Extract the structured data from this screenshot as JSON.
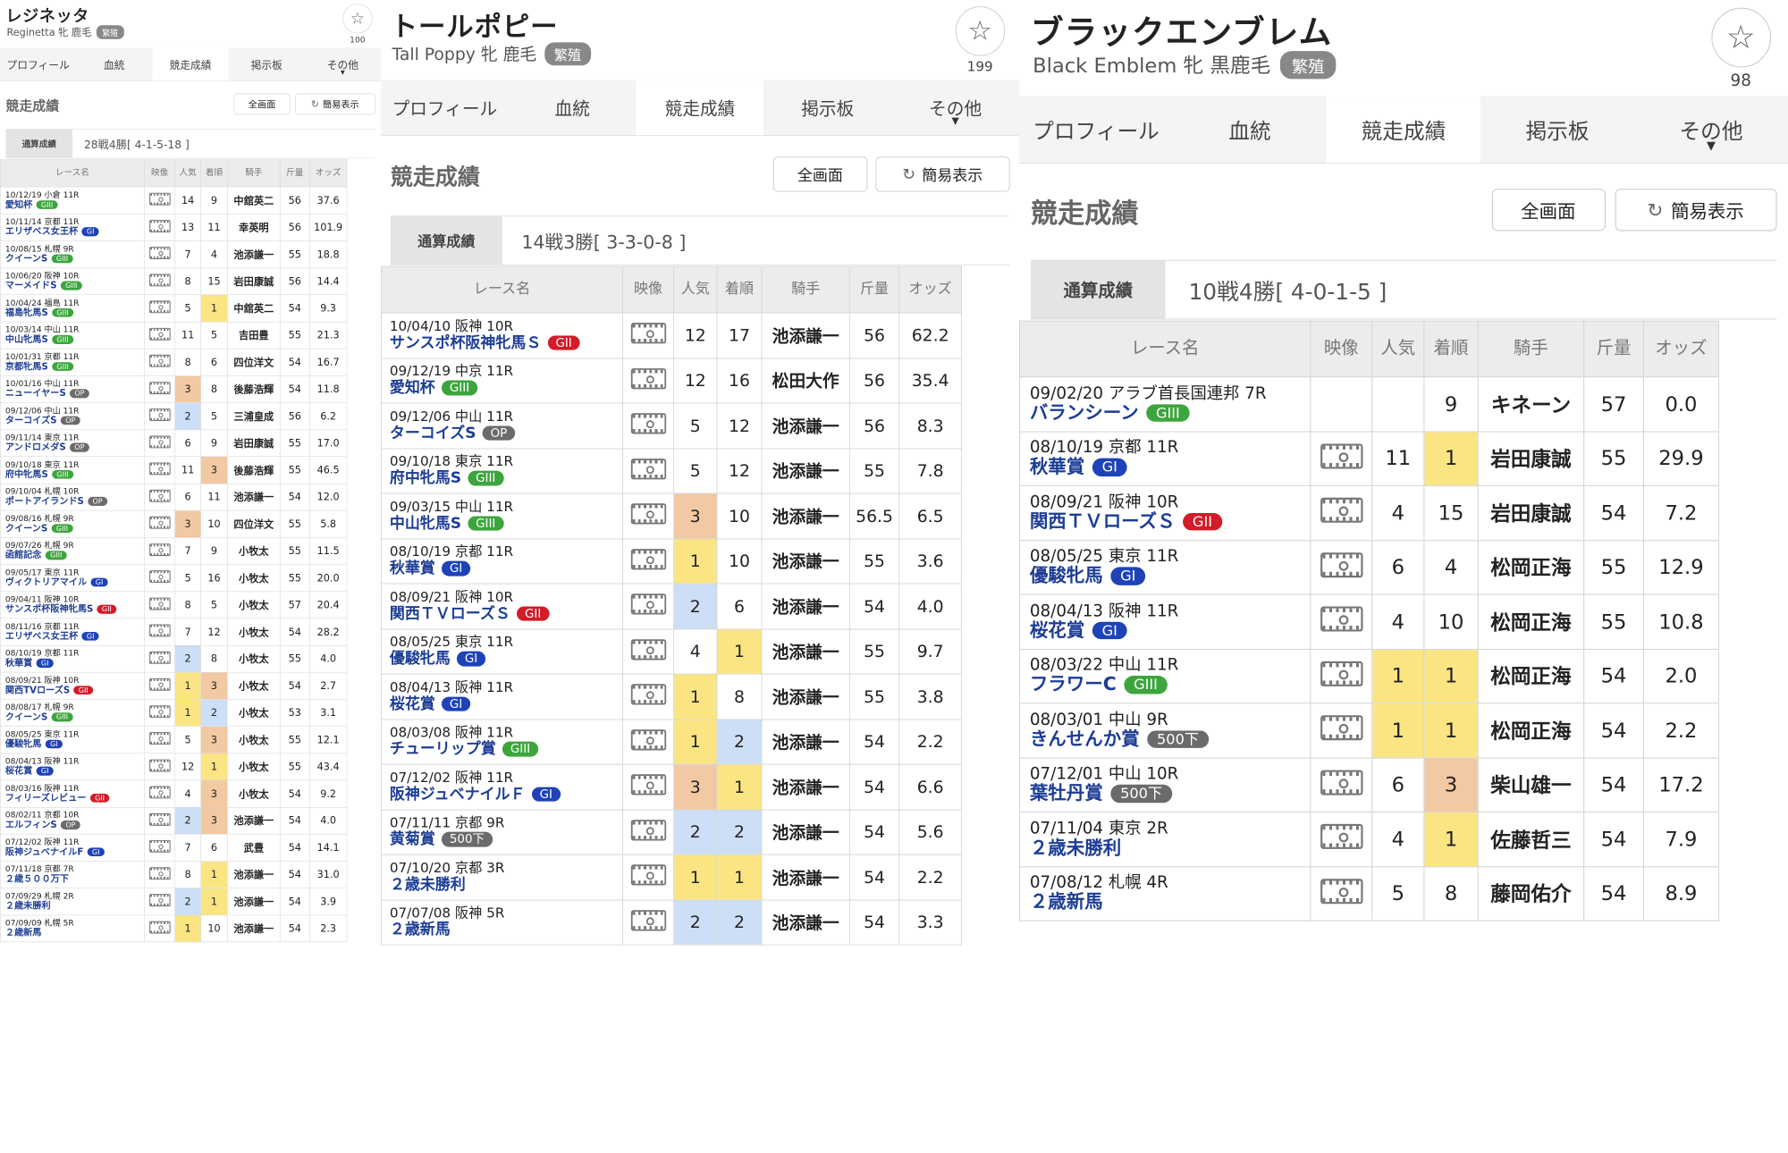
{
  "tabs": [
    "プロフィール",
    "血統",
    "競走成績",
    "掲示板",
    "その他"
  ],
  "section_title": "競走成績",
  "fullscreen_label": "全画面",
  "simple_label": "簡易表示",
  "summary_label": "通算成績",
  "headers": [
    "レース名",
    "映像",
    "人気",
    "着順",
    "騎手",
    "斤量",
    "オッズ"
  ],
  "colors": {
    "grade_GI": "#1e43b8",
    "grade_GII": "#d21c28",
    "grade_GIII": "#3da53d",
    "first": "#fbe582",
    "second": "#cddff6",
    "third": "#f2c9a3"
  },
  "horses": [
    {
      "name": "レジネッタ",
      "sub": "Reginetta 牝 鹿毛",
      "badge": "繁殖",
      "favorites": "100",
      "summary": "28戦4勝[ 4-1-5-18 ]",
      "races": [
        {
          "date": "10/12/19 小倉 11R",
          "name": "愛知杯",
          "grade": "GIII",
          "video": true,
          "pop": "14",
          "pos": "9",
          "jockey": "中舘英二",
          "weight": "56",
          "odds": "37.6"
        },
        {
          "date": "10/11/14 京都 11R",
          "name": "エリザベス女王杯",
          "grade": "GI",
          "video": true,
          "pop": "13",
          "pos": "11",
          "jockey": "幸英明",
          "weight": "56",
          "odds": "101.9"
        },
        {
          "date": "10/08/15 札幌 9R",
          "name": "クイーンS",
          "grade": "GIII",
          "video": true,
          "pop": "7",
          "pos": "4",
          "jockey": "池添謙一",
          "weight": "55",
          "odds": "18.8"
        },
        {
          "date": "10/06/20 阪神 10R",
          "name": "マーメイドS",
          "grade": "GIII",
          "video": true,
          "pop": "8",
          "pos": "15",
          "jockey": "岩田康誠",
          "weight": "56",
          "odds": "14.4"
        },
        {
          "date": "10/04/24 福島 11R",
          "name": "福島牝馬S",
          "grade": "GIII",
          "video": true,
          "pop": "5",
          "pos": "1",
          "jockey": "中舘英二",
          "weight": "54",
          "odds": "9.3"
        },
        {
          "date": "10/03/14 中山 11R",
          "name": "中山牝馬S",
          "grade": "GIII",
          "video": true,
          "pop": "11",
          "pos": "5",
          "jockey": "吉田豊",
          "weight": "55",
          "odds": "21.3"
        },
        {
          "date": "10/01/31 京都 11R",
          "name": "京都牝馬S",
          "grade": "GIII",
          "video": true,
          "pop": "8",
          "pos": "6",
          "jockey": "四位洋文",
          "weight": "54",
          "odds": "16.7"
        },
        {
          "date": "10/01/16 中山 11R",
          "name": "ニューイヤーS",
          "grade": "OP",
          "video": true,
          "pop": "3",
          "pos": "8",
          "jockey": "後藤浩輝",
          "weight": "54",
          "odds": "11.8"
        },
        {
          "date": "09/12/06 中山 11R",
          "name": "ターコイズS",
          "grade": "OP",
          "video": true,
          "pop": "2",
          "pos": "5",
          "jockey": "三浦皇成",
          "weight": "56",
          "odds": "6.2"
        },
        {
          "date": "09/11/14 東京 11R",
          "name": "アンドロメダS",
          "grade": "OP",
          "video": true,
          "pop": "6",
          "pos": "9",
          "jockey": "岩田康誠",
          "weight": "55",
          "odds": "17.0"
        },
        {
          "date": "09/10/18 東京 11R",
          "name": "府中牝馬S",
          "grade": "GIII",
          "video": true,
          "pop": "11",
          "pos": "3",
          "jockey": "後藤浩輝",
          "weight": "55",
          "odds": "46.5"
        },
        {
          "date": "09/10/04 札幌 10R",
          "name": "ポートアイランドS",
          "grade": "OP",
          "video": true,
          "pop": "6",
          "pos": "11",
          "jockey": "池添謙一",
          "weight": "54",
          "odds": "12.0"
        },
        {
          "date": "09/08/16 札幌 9R",
          "name": "クイーンS",
          "grade": "GIII",
          "video": true,
          "pop": "3",
          "pos": "10",
          "jockey": "四位洋文",
          "weight": "55",
          "odds": "5.8"
        },
        {
          "date": "09/07/26 札幌 9R",
          "name": "函館記念",
          "grade": "GIII",
          "video": true,
          "pop": "7",
          "pos": "9",
          "jockey": "小牧太",
          "weight": "55",
          "odds": "11.5"
        },
        {
          "date": "09/05/17 東京 11R",
          "name": "ヴィクトリアマイル",
          "grade": "GI",
          "video": true,
          "pop": "5",
          "pos": "16",
          "jockey": "小牧太",
          "weight": "55",
          "odds": "20.0"
        },
        {
          "date": "09/04/11 阪神 10R",
          "name": "サンスポ杯阪神牝馬S",
          "grade": "GII",
          "video": true,
          "pop": "8",
          "pos": "5",
          "jockey": "小牧太",
          "weight": "57",
          "odds": "20.4"
        },
        {
          "date": "08/11/16 京都 11R",
          "name": "エリザベス女王杯",
          "grade": "GI",
          "video": true,
          "pop": "7",
          "pos": "12",
          "jockey": "小牧太",
          "weight": "54",
          "odds": "28.2"
        },
        {
          "date": "08/10/19 京都 11R",
          "name": "秋華賞",
          "grade": "GI",
          "video": true,
          "pop": "2",
          "pos": "8",
          "jockey": "小牧太",
          "weight": "55",
          "odds": "4.0"
        },
        {
          "date": "08/09/21 阪神 10R",
          "name": "関西TVローズS",
          "grade": "GII",
          "video": true,
          "pop": "1",
          "pos": "3",
          "jockey": "小牧太",
          "weight": "54",
          "odds": "2.7"
        },
        {
          "date": "08/08/17 札幌 9R",
          "name": "クイーンS",
          "grade": "GIII",
          "video": true,
          "pop": "1",
          "pos": "2",
          "jockey": "小牧太",
          "weight": "53",
          "odds": "3.1"
        },
        {
          "date": "08/05/25 東京 11R",
          "name": "優駿牝馬",
          "grade": "GI",
          "video": true,
          "pop": "5",
          "pos": "3",
          "jockey": "小牧太",
          "weight": "55",
          "odds": "12.1"
        },
        {
          "date": "08/04/13 阪神 11R",
          "name": "桜花賞",
          "grade": "GI",
          "video": true,
          "pop": "12",
          "pos": "1",
          "jockey": "小牧太",
          "weight": "55",
          "odds": "43.4"
        },
        {
          "date": "08/03/16 阪神 11R",
          "name": "フィリーズレビュー",
          "grade": "GII",
          "video": true,
          "pop": "4",
          "pos": "3",
          "jockey": "小牧太",
          "weight": "54",
          "odds": "9.2"
        },
        {
          "date": "08/02/11 京都 10R",
          "name": "エルフィンS",
          "grade": "OP",
          "video": true,
          "pop": "2",
          "pos": "3",
          "jockey": "池添謙一",
          "weight": "54",
          "odds": "4.0"
        },
        {
          "date": "07/12/02 阪神 11R",
          "name": "阪神ジュベナイルF",
          "grade": "GI",
          "video": true,
          "pop": "7",
          "pos": "6",
          "jockey": "武豊",
          "weight": "54",
          "odds": "14.1"
        },
        {
          "date": "07/11/18 京都 7R",
          "name": "２歳５００万下",
          "grade": "",
          "video": true,
          "pop": "8",
          "pos": "1",
          "jockey": "池添謙一",
          "weight": "54",
          "odds": "31.0"
        },
        {
          "date": "07/09/29 札幌 2R",
          "name": "２歳未勝利",
          "grade": "",
          "video": true,
          "pop": "2",
          "pos": "1",
          "jockey": "池添謙一",
          "weight": "54",
          "odds": "3.9"
        },
        {
          "date": "07/09/09 札幌 5R",
          "name": "２歳新馬",
          "grade": "",
          "video": true,
          "pop": "1",
          "pos": "10",
          "jockey": "池添謙一",
          "weight": "54",
          "odds": "2.3"
        }
      ]
    },
    {
      "name": "トールポピー",
      "sub": "Tall Poppy 牝 鹿毛",
      "badge": "繁殖",
      "favorites": "199",
      "summary": "14戦3勝[ 3-3-0-8 ]",
      "races": [
        {
          "date": "10/04/10 阪神 10R",
          "name": "サンスポ杯阪神牝馬Ｓ",
          "grade": "GII",
          "video": true,
          "pop": "12",
          "pos": "17",
          "jockey": "池添謙一",
          "weight": "56",
          "odds": "62.2"
        },
        {
          "date": "09/12/19 中京 11R",
          "name": "愛知杯",
          "grade": "GIII",
          "video": true,
          "pop": "12",
          "pos": "16",
          "jockey": "松田大作",
          "weight": "56",
          "odds": "35.4"
        },
        {
          "date": "09/12/06 中山 11R",
          "name": "ターコイズS",
          "grade": "OP",
          "video": true,
          "pop": "5",
          "pos": "12",
          "jockey": "池添謙一",
          "weight": "56",
          "odds": "8.3"
        },
        {
          "date": "09/10/18 東京 11R",
          "name": "府中牝馬S",
          "grade": "GIII",
          "video": true,
          "pop": "5",
          "pos": "12",
          "jockey": "池添謙一",
          "weight": "55",
          "odds": "7.8"
        },
        {
          "date": "09/03/15 中山 11R",
          "name": "中山牝馬S",
          "grade": "GIII",
          "video": true,
          "pop": "3",
          "pos": "10",
          "jockey": "池添謙一",
          "weight": "56.5",
          "odds": "6.5"
        },
        {
          "date": "08/10/19 京都 11R",
          "name": "秋華賞",
          "grade": "GI",
          "video": true,
          "pop": "1",
          "pos": "10",
          "jockey": "池添謙一",
          "weight": "55",
          "odds": "3.6"
        },
        {
          "date": "08/09/21 阪神 10R",
          "name": "関西ＴＶローズＳ",
          "grade": "GII",
          "video": true,
          "pop": "2",
          "pos": "6",
          "jockey": "池添謙一",
          "weight": "54",
          "odds": "4.0"
        },
        {
          "date": "08/05/25 東京 11R",
          "name": "優駿牝馬",
          "grade": "GI",
          "video": true,
          "pop": "4",
          "pos": "1",
          "jockey": "池添謙一",
          "weight": "55",
          "odds": "9.7"
        },
        {
          "date": "08/04/13 阪神 11R",
          "name": "桜花賞",
          "grade": "GI",
          "video": true,
          "pop": "1",
          "pos": "8",
          "jockey": "池添謙一",
          "weight": "55",
          "odds": "3.8"
        },
        {
          "date": "08/03/08 阪神 11R",
          "name": "チューリップ賞",
          "grade": "GIII",
          "video": true,
          "pop": "1",
          "pos": "2",
          "jockey": "池添謙一",
          "weight": "54",
          "odds": "2.2"
        },
        {
          "date": "07/12/02 阪神 11R",
          "name": "阪神ジュベナイルＦ",
          "grade": "GI",
          "video": true,
          "pop": "3",
          "pos": "1",
          "jockey": "池添謙一",
          "weight": "54",
          "odds": "6.6"
        },
        {
          "date": "07/11/11 京都 9R",
          "name": "黄菊賞",
          "grade": "500下",
          "video": true,
          "pop": "2",
          "pos": "2",
          "jockey": "池添謙一",
          "weight": "54",
          "odds": "5.6"
        },
        {
          "date": "07/10/20 京都 3R",
          "name": "２歳未勝利",
          "grade": "",
          "video": true,
          "pop": "1",
          "pos": "1",
          "jockey": "池添謙一",
          "weight": "54",
          "odds": "2.2"
        },
        {
          "date": "07/07/08 阪神 5R",
          "name": "２歳新馬",
          "grade": "",
          "video": true,
          "pop": "2",
          "pos": "2",
          "jockey": "池添謙一",
          "weight": "54",
          "odds": "3.3"
        }
      ]
    },
    {
      "name": "ブラックエンブレム",
      "sub": "Black Emblem 牝 黒鹿毛",
      "badge": "繁殖",
      "favorites": "98",
      "summary": "10戦4勝[ 4-0-1-5 ]",
      "races": [
        {
          "date": "09/02/20 アラブ首長国連邦 7R",
          "name": "バランシーン",
          "grade": "GIII",
          "video": false,
          "pop": "",
          "pos": "9",
          "jockey": "キネーン",
          "weight": "57",
          "odds": "0.0"
        },
        {
          "date": "08/10/19 京都 11R",
          "name": "秋華賞",
          "grade": "GI",
          "video": true,
          "pop": "11",
          "pos": "1",
          "jockey": "岩田康誠",
          "weight": "55",
          "odds": "29.9"
        },
        {
          "date": "08/09/21 阪神 10R",
          "name": "関西ＴＶローズＳ",
          "grade": "GII",
          "video": true,
          "pop": "4",
          "pos": "15",
          "jockey": "岩田康誠",
          "weight": "54",
          "odds": "7.2"
        },
        {
          "date": "08/05/25 東京 11R",
          "name": "優駿牝馬",
          "grade": "GI",
          "video": true,
          "pop": "6",
          "pos": "4",
          "jockey": "松岡正海",
          "weight": "55",
          "odds": "12.9"
        },
        {
          "date": "08/04/13 阪神 11R",
          "name": "桜花賞",
          "grade": "GI",
          "video": true,
          "pop": "4",
          "pos": "10",
          "jockey": "松岡正海",
          "weight": "55",
          "odds": "10.8"
        },
        {
          "date": "08/03/22 中山 11R",
          "name": "フラワーC",
          "grade": "GIII",
          "video": true,
          "pop": "1",
          "pos": "1",
          "jockey": "松岡正海",
          "weight": "54",
          "odds": "2.0"
        },
        {
          "date": "08/03/01 中山 9R",
          "name": "きんせんか賞",
          "grade": "500下",
          "video": true,
          "pop": "1",
          "pos": "1",
          "jockey": "松岡正海",
          "weight": "54",
          "odds": "2.2"
        },
        {
          "date": "07/12/01 中山 10R",
          "name": "葉牡丹賞",
          "grade": "500下",
          "video": true,
          "pop": "6",
          "pos": "3",
          "jockey": "柴山雄一",
          "weight": "54",
          "odds": "17.2"
        },
        {
          "date": "07/11/04 東京 2R",
          "name": "２歳未勝利",
          "grade": "",
          "video": true,
          "pop": "4",
          "pos": "1",
          "jockey": "佐藤哲三",
          "weight": "54",
          "odds": "7.9"
        },
        {
          "date": "07/08/12 札幌 4R",
          "name": "２歳新馬",
          "grade": "",
          "video": true,
          "pop": "5",
          "pos": "8",
          "jockey": "藤岡佑介",
          "weight": "54",
          "odds": "8.9"
        }
      ]
    }
  ]
}
